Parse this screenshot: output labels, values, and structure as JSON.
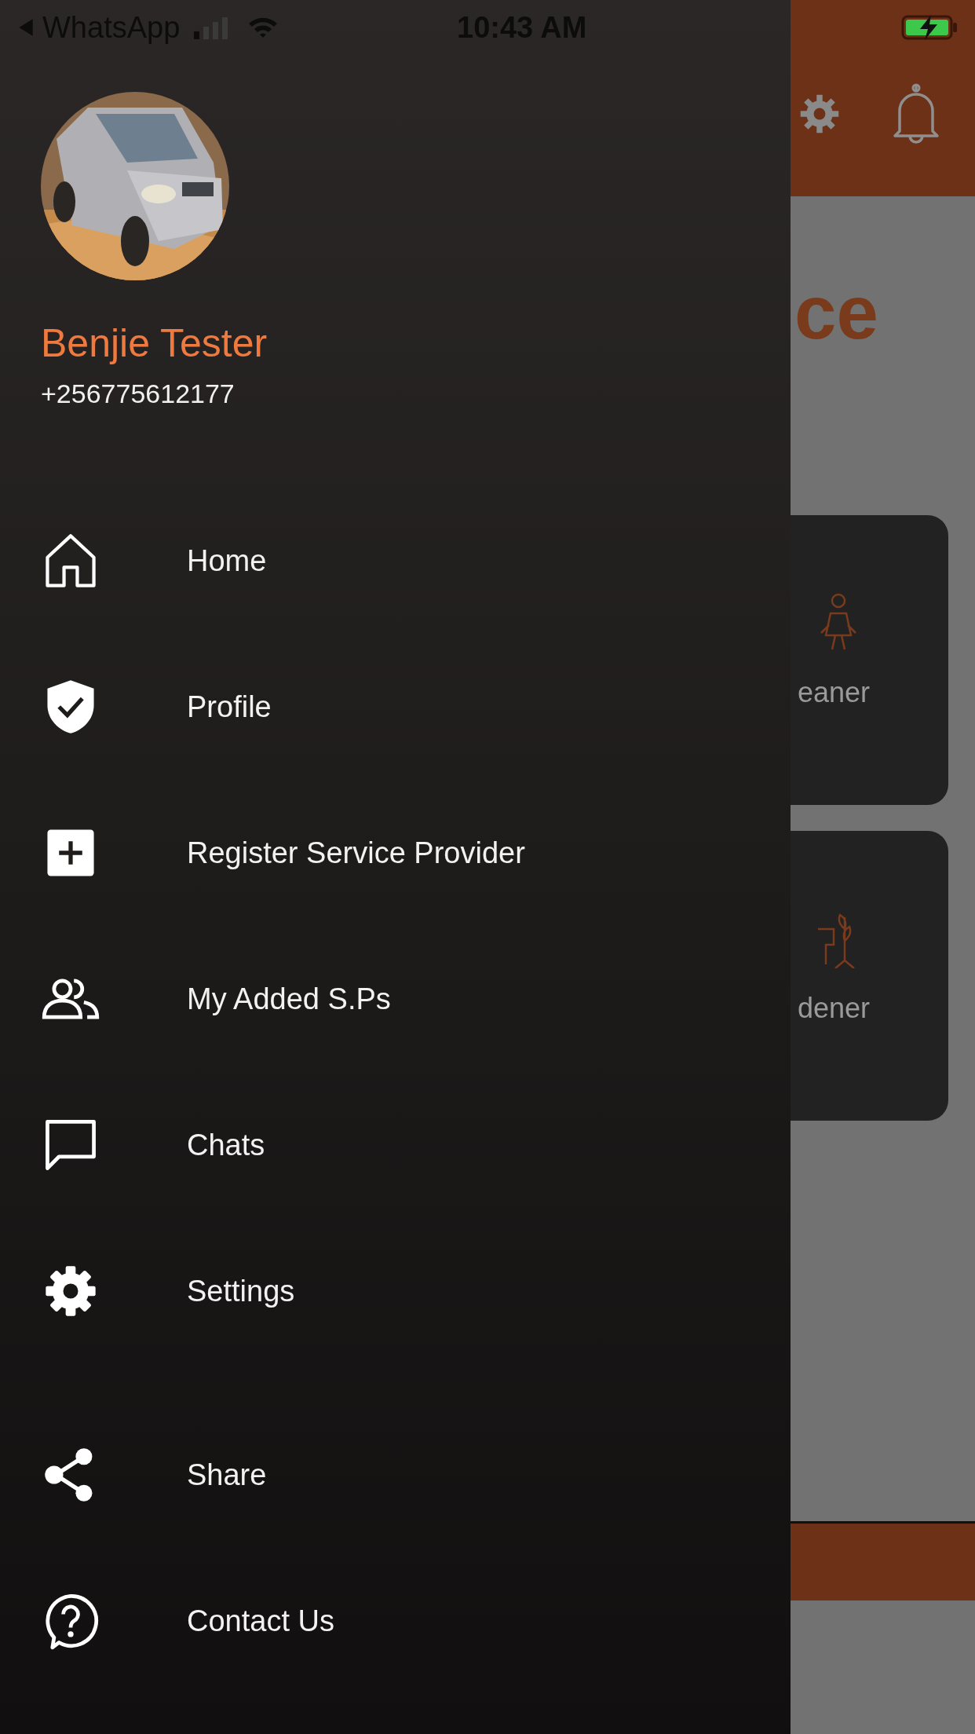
{
  "status_bar": {
    "back_app": "WhatsApp",
    "time": "10:43 AM"
  },
  "background_screen": {
    "title_fragment": "ce",
    "cards": [
      {
        "label_fragment": "eaner",
        "kind": "cleaner"
      },
      {
        "label_fragment": "dener",
        "kind": "gardener"
      }
    ]
  },
  "drawer": {
    "user": {
      "name": "Benjie Tester",
      "phone": "+256775612177"
    },
    "menu_groups": [
      [
        {
          "label": "Home",
          "kind": "home"
        },
        {
          "label": "Profile",
          "kind": "shield"
        },
        {
          "label": "Register Service Provider",
          "kind": "add"
        },
        {
          "label": "My Added S.Ps",
          "kind": "people"
        },
        {
          "label": "Chats",
          "kind": "chat"
        },
        {
          "label": "Settings",
          "kind": "settings"
        }
      ],
      [
        {
          "label": "Share",
          "kind": "share"
        },
        {
          "label": "Contact Us",
          "kind": "help"
        }
      ]
    ]
  }
}
